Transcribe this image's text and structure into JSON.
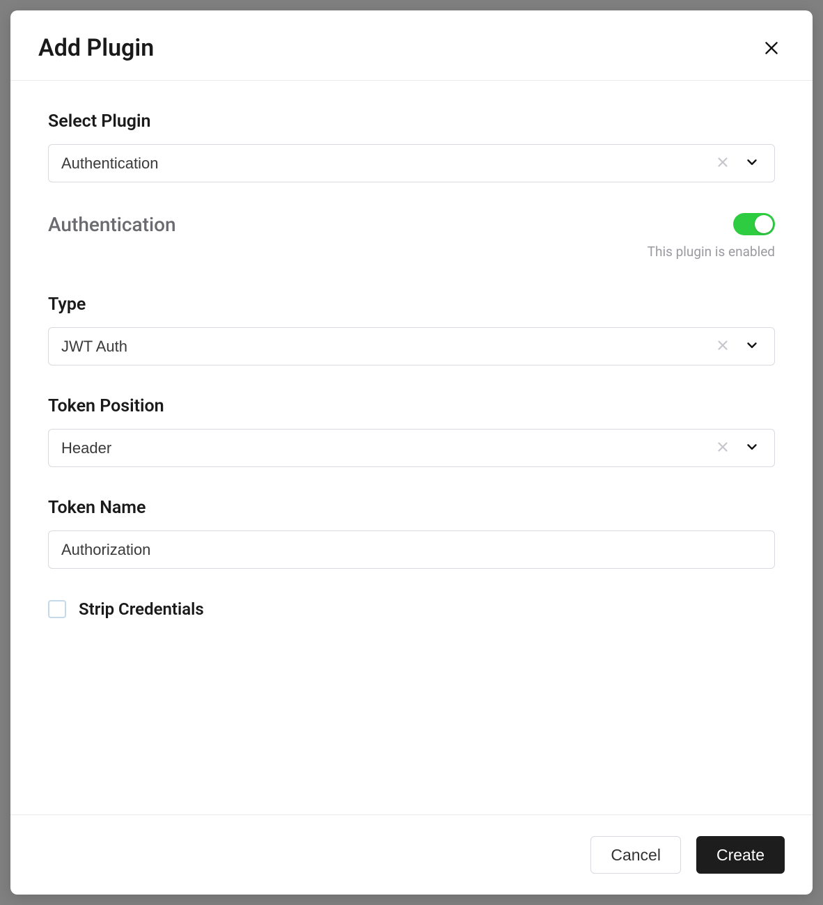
{
  "modal": {
    "title": "Add Plugin"
  },
  "form": {
    "select_plugin": {
      "label": "Select Plugin",
      "value": "Authentication"
    },
    "toggle": {
      "title": "Authentication",
      "caption": "This plugin is enabled",
      "enabled": true
    },
    "type": {
      "label": "Type",
      "value": "JWT Auth"
    },
    "token_position": {
      "label": "Token Position",
      "value": "Header"
    },
    "token_name": {
      "label": "Token Name",
      "value": "Authorization"
    },
    "strip_credentials": {
      "label": "Strip Credentials",
      "checked": false
    }
  },
  "footer": {
    "cancel": "Cancel",
    "create": "Create"
  }
}
